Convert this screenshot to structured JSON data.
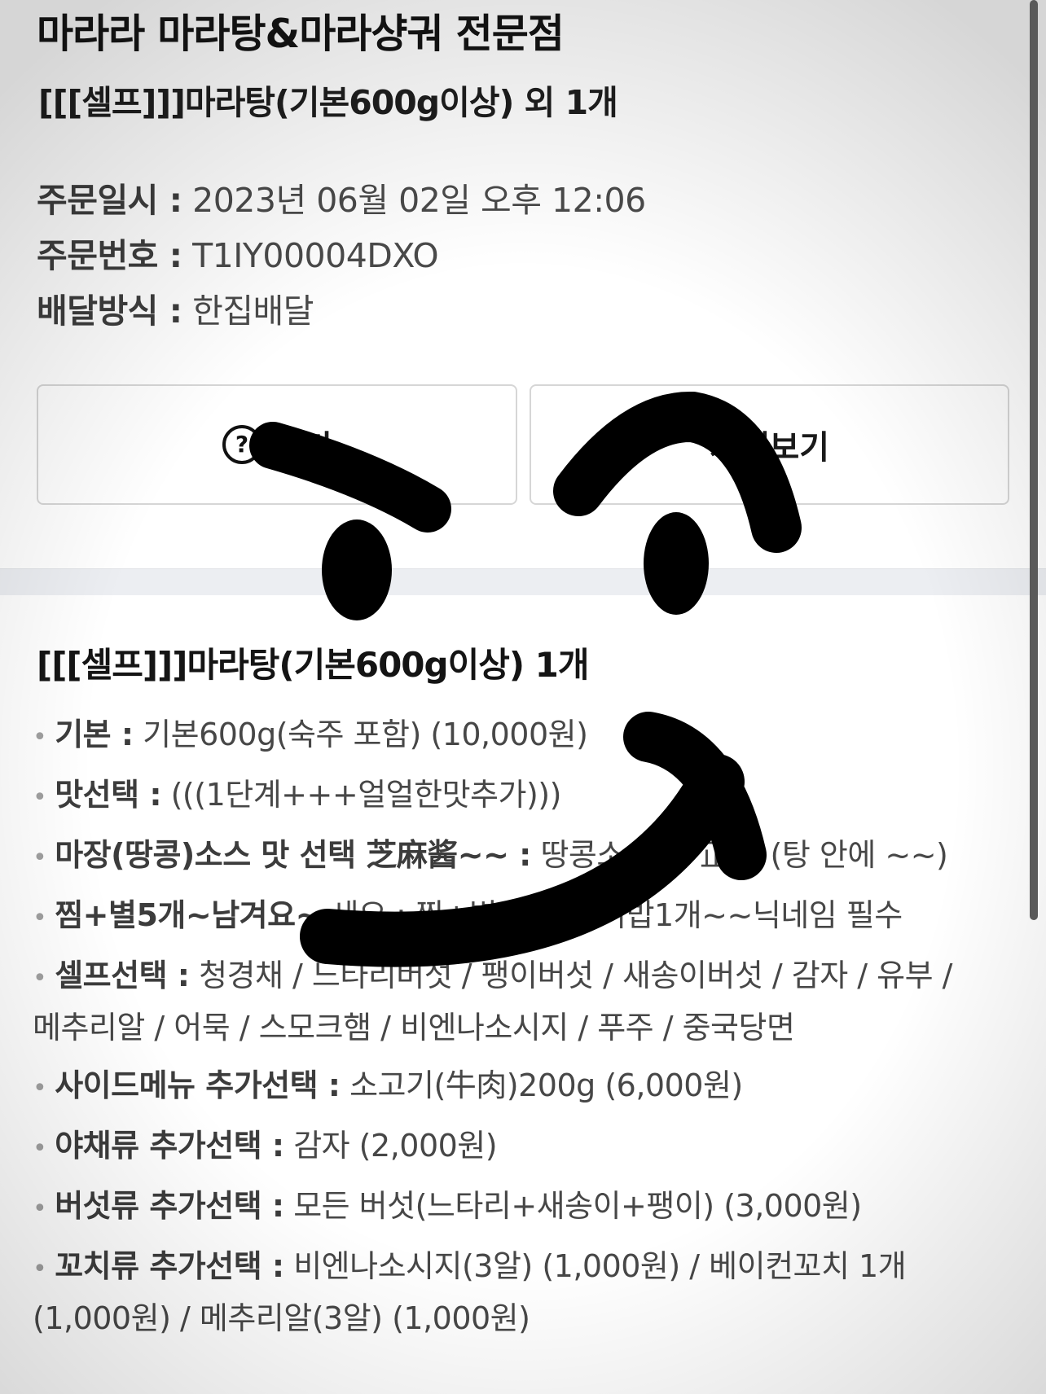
{
  "header": {
    "store_name": "마라라 마라탕&마라샹궈 전문점",
    "order_summary": "[[[셀프]]]마라탕(기본600g이상) 외 1개"
  },
  "order_info": {
    "date_label": "주문일시 :",
    "date_value": "2023년 06월 02일 오후 12:06",
    "number_label": "주문번호 :",
    "number_value": "T1IY00004DXO",
    "method_label": "배달방식 :",
    "method_value": "한집배달"
  },
  "buttons": {
    "help_label": "하기",
    "store_label": "가게보기"
  },
  "icons": {
    "help": "question-circle-icon",
    "bullet": "dot-bullet-icon"
  },
  "item": {
    "title": "[[[셀프]]]마라탕(기본600g이상) 1개",
    "options": [
      {
        "label": "기본 :",
        "value": "기본600g(숙주 포함) (10,000원)"
      },
      {
        "label": "맛선택 :",
        "value": "(((1단계+++얼얼한맛추가)))"
      },
      {
        "label": "마장(땅콩)소스 맛 선택 芝麻酱~~ :",
        "value": "땅콩소스 맛 正常 (탕 안에 ~~)"
      },
      {
        "label": "찜+별5개~남겨요~",
        "value": "세요 : 찜+별5개~공기밥1개~~닉네임 필수"
      },
      {
        "label": "셀프선택 :",
        "value": "청경채 / 느타리버섯 / 팽이버섯 / 새송이버섯 / 감자 / 유부 / 메추리알 / 어묵 / 스모크햄 / 비엔나소시지 / 푸주 / 중국당면"
      },
      {
        "label": "사이드메뉴 추가선택 :",
        "value": "소고기(牛肉)200g (6,000원)"
      },
      {
        "label": "야채류 추가선택 :",
        "value": "감자 (2,000원)"
      },
      {
        "label": "버섯류 추가선택 :",
        "value": "모든 버섯(느타리+새송이+팽이) (3,000원)"
      },
      {
        "label": "꼬치류 추가선택 :",
        "value": "비엔나소시지(3알) (1,000원) / 베이컨꼬치 1개 (1,000원) / 메추리알(3알) (1,000원)"
      }
    ]
  },
  "colors": {
    "divider": "#eceef2",
    "button_border": "#d6d6d6",
    "doodle": "#000000"
  }
}
